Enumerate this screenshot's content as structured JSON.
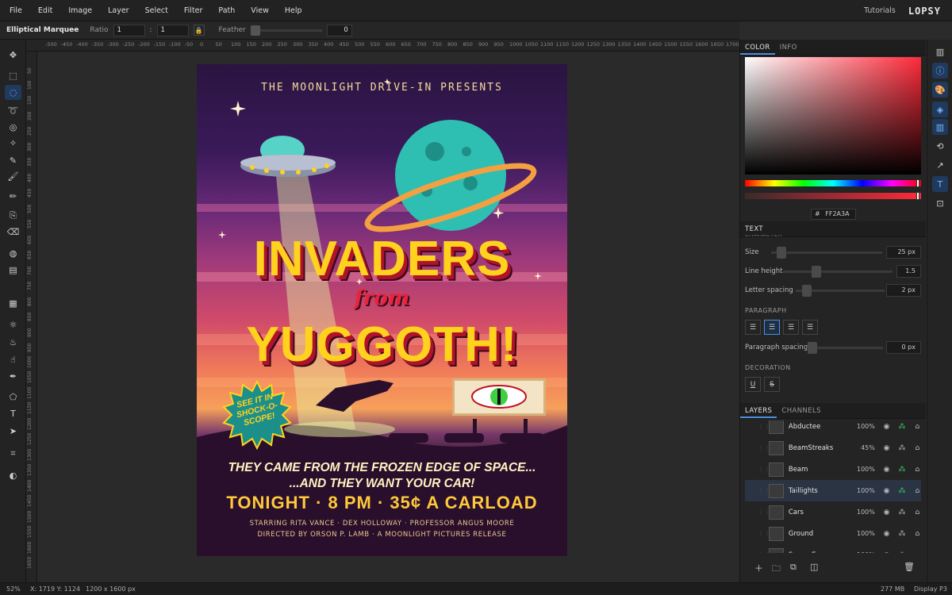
{
  "menu": {
    "items": [
      "File",
      "Edit",
      "Image",
      "Layer",
      "Select",
      "Filter",
      "Path",
      "View",
      "Help"
    ],
    "tutorials": "Tutorials",
    "logo": "LOPSY"
  },
  "options": {
    "tool_name": "Elliptical Marquee",
    "ratio_label": "Ratio",
    "ratio_w": "1",
    "ratio_sep": ":",
    "ratio_h": "1",
    "feather_label": "Feather",
    "feather_value": "0"
  },
  "tools": [
    {
      "name": "move-tool",
      "icon": "✥"
    },
    {
      "name": "rect-marquee-tool",
      "icon": "⬚"
    },
    {
      "name": "ellipse-marquee-tool",
      "icon": "◌",
      "active": true
    },
    {
      "name": "lasso-tool",
      "icon": "➰"
    },
    {
      "name": "quick-select-tool",
      "icon": "◎"
    },
    {
      "name": "magic-wand-tool",
      "icon": "✧"
    },
    {
      "name": "eyedropper-tool",
      "icon": "✎"
    },
    {
      "name": "brush-tool",
      "icon": "🖌"
    },
    {
      "name": "pencil-tool",
      "icon": "✏"
    },
    {
      "name": "clone-tool",
      "icon": "⎘"
    },
    {
      "name": "eraser-tool",
      "icon": "⌫"
    },
    {
      "name": "fill-tool",
      "icon": "◍"
    },
    {
      "name": "gradient-tool",
      "icon": "▤"
    },
    {
      "name": "pattern-tool",
      "icon": "▦"
    },
    {
      "name": "dodge-tool",
      "icon": "☼"
    },
    {
      "name": "burn-tool",
      "icon": "♨"
    },
    {
      "name": "smudge-tool",
      "icon": "☝"
    },
    {
      "name": "pen-tool",
      "icon": "✒"
    },
    {
      "name": "shape-tool",
      "icon": "⬠"
    },
    {
      "name": "text-tool",
      "icon": "T"
    },
    {
      "name": "path-select-tool",
      "icon": "➤"
    },
    {
      "name": "crop-tool",
      "icon": "⌗"
    },
    {
      "name": "color-swap-tool",
      "icon": "◐"
    }
  ],
  "ruler": {
    "top": [
      "-500",
      "-450",
      "-400",
      "-350",
      "-300",
      "-250",
      "-200",
      "-150",
      "-100",
      "-50",
      "0",
      "50",
      "100",
      "150",
      "200",
      "250",
      "300",
      "350",
      "400",
      "450",
      "500",
      "550",
      "600",
      "650",
      "700",
      "750",
      "800",
      "850",
      "900",
      "950",
      "1000",
      "1050",
      "1100",
      "1150",
      "1200",
      "1250",
      "1300",
      "1350",
      "1400",
      "1450",
      "1500",
      "1550",
      "1600",
      "1650",
      "1700"
    ],
    "left": [
      "50",
      "100",
      "150",
      "200",
      "250",
      "300",
      "350",
      "400",
      "450",
      "500",
      "550",
      "600",
      "650",
      "700",
      "750",
      "800",
      "850",
      "900",
      "950",
      "1000",
      "1050",
      "1100",
      "1150",
      "1200",
      "1250",
      "1300",
      "1350",
      "1400",
      "1450",
      "1500",
      "1550",
      "1600",
      "1650"
    ]
  },
  "poster": {
    "presents": "THE MOONLIGHT DRIVE-IN PRESENTS",
    "title_line1": "INVADERS",
    "title_from": "from",
    "title_line2": "YUGGOTH!",
    "badge": "SEE IT IN SHOCK-O-SCOPE!",
    "tagline1": "THEY CAME FROM THE FROZEN EDGE OF SPACE...",
    "tagline2": "...AND THEY WANT YOUR CAR!",
    "tonight": "TONIGHT · 8 PM · 35¢ A CARLOAD",
    "credits1": "STARRING RITA VANCE · DEX HOLLOWAY · PROFESSOR ANGUS MOORE",
    "credits2": "DIRECTED BY ORSON P. LAMB · A MOONLIGHT PICTURES RELEASE"
  },
  "color_panel": {
    "tabs": [
      "COLOR",
      "INFO"
    ],
    "hex_prefix": "#",
    "hex": "FF2A3A",
    "accent": "#ff2a3a"
  },
  "text_panel": {
    "title": "TEXT",
    "character": "CHARACTER",
    "size_label": "Size",
    "size_value": "25 px",
    "line_height_label": "Line height",
    "line_height_value": "1.5",
    "letter_spacing_label": "Letter spacing",
    "letter_spacing_value": "2 px",
    "paragraph": "PARAGRAPH",
    "paragraph_spacing_label": "Paragraph spacing",
    "paragraph_spacing_value": "0 px",
    "decoration": "DECORATION",
    "underline": "U",
    "strike": "S"
  },
  "layers_panel": {
    "tabs": [
      "LAYERS",
      "CHANNELS"
    ],
    "layers": [
      {
        "name": "Abductee",
        "opacity": "100%"
      },
      {
        "name": "BeamStreaks",
        "opacity": "45%"
      },
      {
        "name": "Beam",
        "opacity": "100%"
      },
      {
        "name": "Taillights",
        "opacity": "100%",
        "selected": true
      },
      {
        "name": "Cars",
        "opacity": "100%"
      },
      {
        "name": "Ground",
        "opacity": "100%"
      },
      {
        "name": "ScreenEye",
        "opacity": "100%"
      }
    ]
  },
  "status": {
    "zoom": "52%",
    "coords": "X: 1719  Y: 1124",
    "dimensions": "1200 x 1600",
    "dimensions_unit": "px",
    "memory": "277 MB",
    "display": "Display P3"
  }
}
